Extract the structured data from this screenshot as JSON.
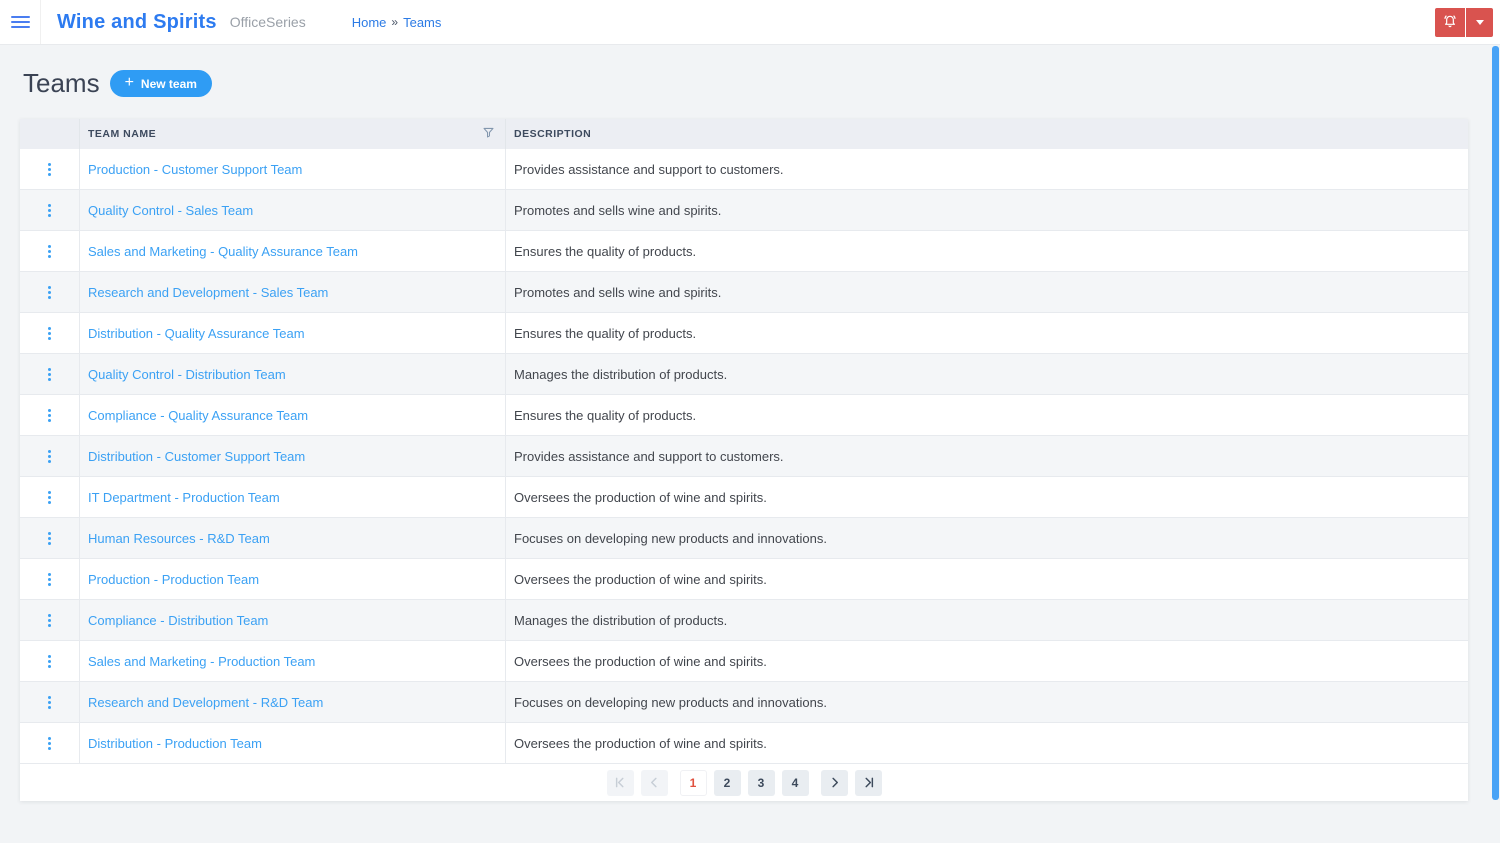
{
  "header": {
    "app_title": "Wine and Spirits",
    "app_subtitle": "OfficeSeries",
    "breadcrumb": {
      "home": "Home",
      "separator": "»",
      "current": "Teams"
    }
  },
  "page": {
    "title": "Teams",
    "new_team_button": {
      "icon": "plus-icon",
      "label": "New team",
      "plus_glyph": "+"
    }
  },
  "table": {
    "columns": {
      "team_name": "TEAM NAME",
      "description": "DESCRIPTION"
    },
    "header_icons": {
      "filter": "filter-funnel-icon"
    },
    "row_icon": "kebab-menu-icon",
    "rows": [
      {
        "name": "Production - Customer Support Team",
        "description": "Provides assistance and support to customers."
      },
      {
        "name": "Quality Control - Sales Team",
        "description": "Promotes and sells wine and spirits."
      },
      {
        "name": "Sales and Marketing - Quality Assurance Team",
        "description": "Ensures the quality of products."
      },
      {
        "name": "Research and Development - Sales Team",
        "description": "Promotes and sells wine and spirits."
      },
      {
        "name": "Distribution - Quality Assurance Team",
        "description": "Ensures the quality of products."
      },
      {
        "name": "Quality Control - Distribution Team",
        "description": "Manages the distribution of products."
      },
      {
        "name": "Compliance - Quality Assurance Team",
        "description": "Ensures the quality of products."
      },
      {
        "name": "Distribution - Customer Support Team",
        "description": "Provides assistance and support to customers."
      },
      {
        "name": "IT Department - Production Team",
        "description": "Oversees the production of wine and spirits."
      },
      {
        "name": "Human Resources - R&D Team",
        "description": "Focuses on developing new products and innovations."
      },
      {
        "name": "Production - Production Team",
        "description": "Oversees the production of wine and spirits."
      },
      {
        "name": "Compliance - Distribution Team",
        "description": "Manages the distribution of products."
      },
      {
        "name": "Sales and Marketing - Production Team",
        "description": "Oversees the production of wine and spirits."
      },
      {
        "name": "Research and Development - R&D Team",
        "description": "Focuses on developing new products and innovations."
      },
      {
        "name": "Distribution - Production Team",
        "description": "Oversees the production of wine and spirits."
      }
    ]
  },
  "pagination": {
    "pages": [
      "1",
      "2",
      "3",
      "4"
    ],
    "current": "1",
    "nav_icons": {
      "first": "first-page-icon",
      "prev": "previous-page-icon",
      "next": "next-page-icon",
      "last": "last-page-icon"
    }
  },
  "topbar_icons": {
    "menu": "hamburger-menu-icon",
    "notifications": "bell-icon",
    "account": "caret-down-icon"
  },
  "colors": {
    "brand_title_blue": "#2d7bf0",
    "link_blue": "#3ba1f4",
    "breadcrumb_blue": "#2c7be5",
    "accent_button_blue": "#2f9cf4",
    "danger_red": "#d9534f",
    "scrollbar_blue": "#49a3f6",
    "current_page_red": "#e0513f",
    "table_header_bg": "#eceef3",
    "row_alt_bg": "#f4f6f8"
  }
}
